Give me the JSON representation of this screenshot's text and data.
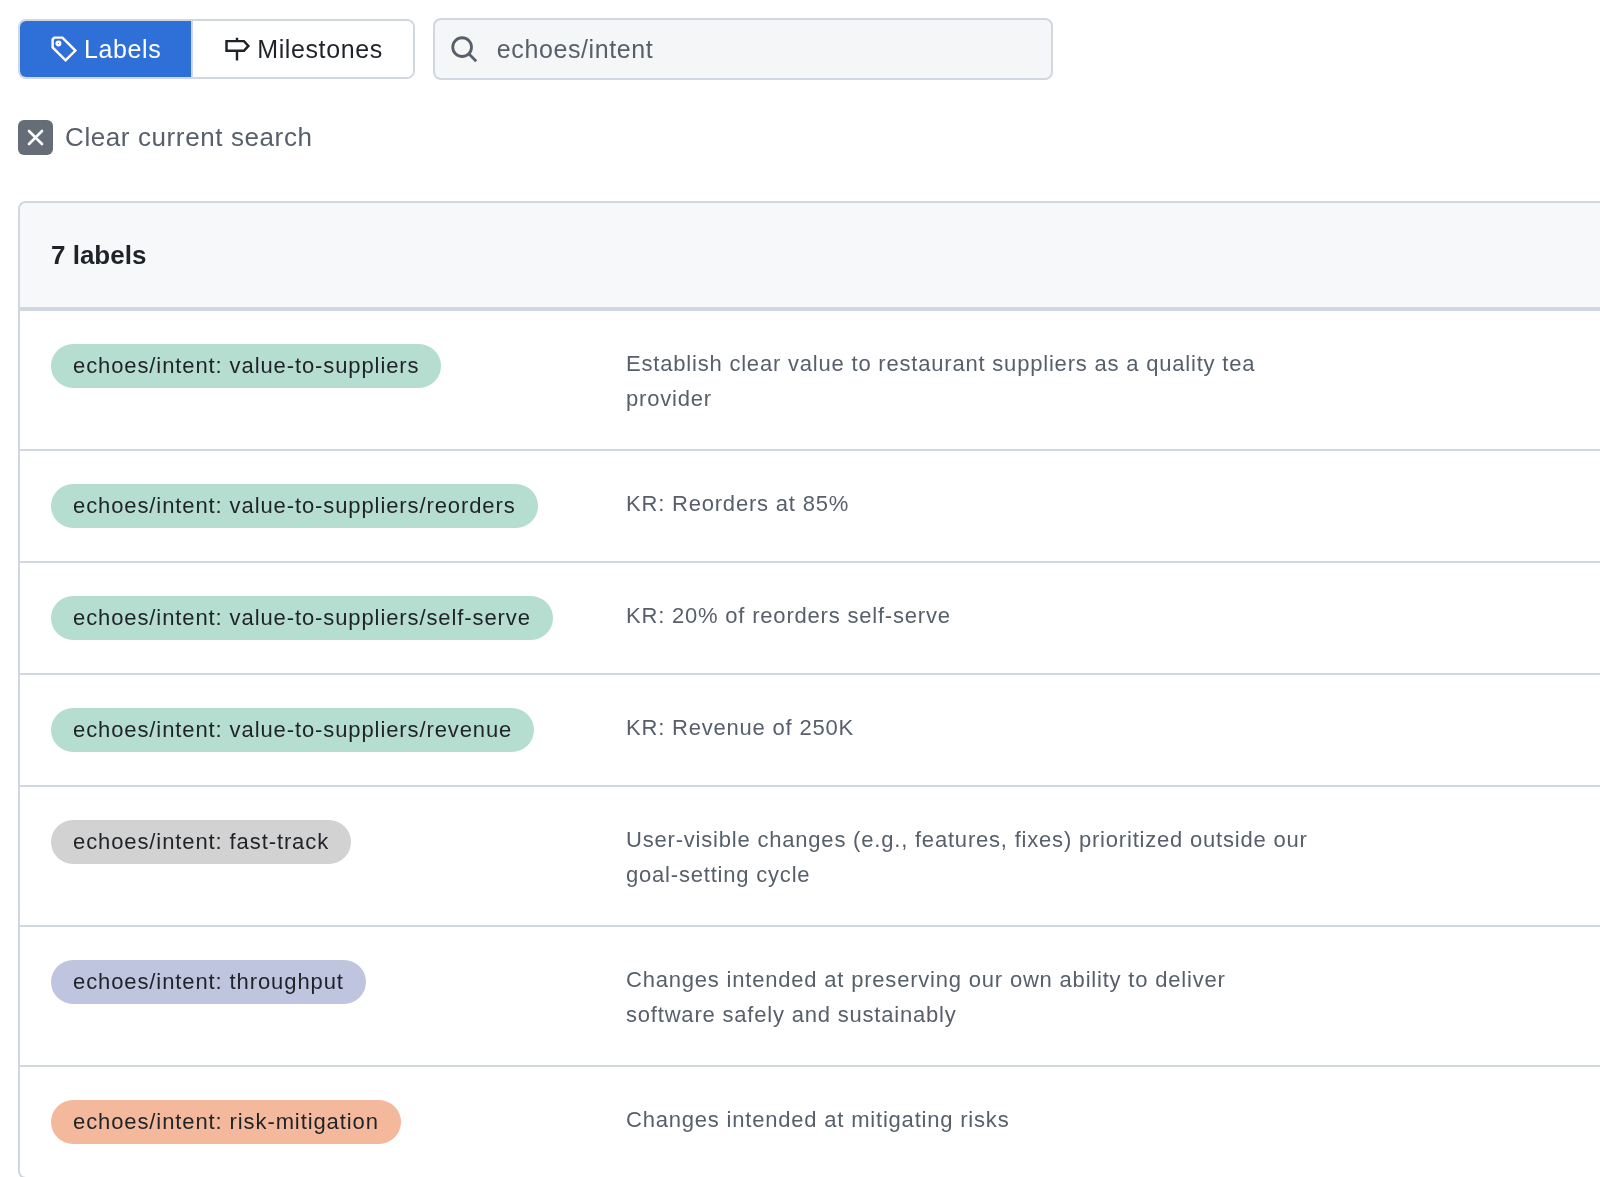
{
  "tabs": [
    {
      "label": "Labels",
      "kind": "tag",
      "selected": true
    },
    {
      "label": "Milestones",
      "kind": "milestone",
      "selected": false
    }
  ],
  "search": {
    "value": "echoes/intent"
  },
  "clear_search": {
    "label": "Clear current search"
  },
  "labels_table": {
    "count": "7 labels",
    "rows": [
      {
        "name": "echoes/intent: value-to-suppliers",
        "color": "#b5ddd0",
        "description": "Establish clear value to restaurant suppliers as a quality tea provider"
      },
      {
        "name": "echoes/intent: value-to-suppliers/reorders",
        "color": "#b5ddd0",
        "description": "KR: Reorders at 85%"
      },
      {
        "name": "echoes/intent: value-to-suppliers/self-serve",
        "color": "#b5ddd0",
        "description": "KR: 20% of reorders self-serve"
      },
      {
        "name": "echoes/intent: value-to-suppliers/revenue",
        "color": "#b5ddd0",
        "description": "KR: Revenue of 250K"
      },
      {
        "name": "echoes/intent: fast-track",
        "color": "#d2d2d2",
        "description": "User-visible changes (e.g., features, fixes) prioritized outside our goal-setting cycle"
      },
      {
        "name": "echoes/intent: throughput",
        "color": "#bfc5df",
        "description": "Changes intended at preserving our own ability to deliver software safely and sustainably"
      },
      {
        "name": "echoes/intent: risk-mitigation",
        "color": "#f4b99c",
        "description": "Changes intended at mitigating risks"
      }
    ]
  }
}
